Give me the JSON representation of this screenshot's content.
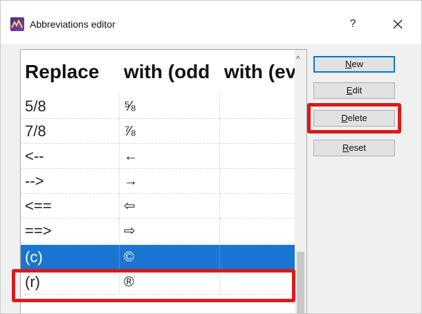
{
  "window": {
    "title": "Abbreviations editor",
    "help_glyph": "?",
    "close_glyph": "✕"
  },
  "grid": {
    "headers": [
      "Replace",
      "with (odd",
      "with (ev"
    ],
    "rows": [
      {
        "replace": "5/8",
        "odd": "⅝",
        "even": ""
      },
      {
        "replace": "7/8",
        "odd": "⅞",
        "even": ""
      },
      {
        "replace": "<--",
        "odd": "←",
        "even": ""
      },
      {
        "replace": "-->",
        "odd": "→",
        "even": ""
      },
      {
        "replace": "<==",
        "odd": "⇦",
        "even": ""
      },
      {
        "replace": "==>",
        "odd": "⇨",
        "even": ""
      },
      {
        "replace": "(c)",
        "odd": "©",
        "even": ""
      },
      {
        "replace": "(r)",
        "odd": "®",
        "even": ""
      }
    ],
    "selected_row": 6
  },
  "buttons": {
    "new": {
      "pre": "",
      "key": "N",
      "post": "ew"
    },
    "edit": {
      "pre": "",
      "key": "E",
      "post": "dit"
    },
    "delete": {
      "pre": "",
      "key": "D",
      "post": "elete"
    },
    "reset": {
      "pre": "",
      "key": "R",
      "post": "eset"
    }
  },
  "colors": {
    "selection": "#1b75d2",
    "highlight_outline": "#d81b1b",
    "default_button_border": "#0078d7"
  }
}
